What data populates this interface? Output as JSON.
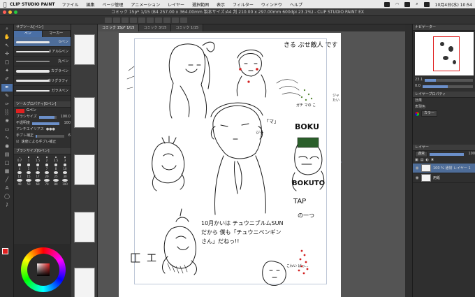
{
  "menubar": {
    "app_name": "CLIP STUDIO PAINT",
    "items": [
      "ファイル",
      "編集",
      "ページ管理",
      "アニメーション",
      "レイヤー",
      "選択範囲",
      "表示",
      "フィルター",
      "ウィンドウ",
      "ヘルプ"
    ],
    "datetime": "10月4日(水)  10:54"
  },
  "titlebar": {
    "title": "コミック 15p* 1/15 (B4 257.00 x 364.00mm 製本サイズ:A4 判 210.00 x 297.00mm 600dpi 23.1%) - CLIP STUDIO PAINT EX"
  },
  "doc_tabs": [
    "コミック 15p* 1/15",
    "コミック 3/15",
    "コミック 1/15"
  ],
  "subtool": {
    "title": "サブツール[ペン]",
    "tabs": [
      "ペン",
      "マーカー"
    ],
    "brushes": [
      {
        "name": "Gペン",
        "selected": true
      },
      {
        "name": "リアルGペン",
        "selected": false
      },
      {
        "name": "丸ペン",
        "selected": false
      },
      {
        "name": "カブラペン",
        "selected": false
      },
      {
        "name": "カリグラフィ",
        "selected": false
      },
      {
        "name": "ガラスペン",
        "selected": false
      }
    ]
  },
  "tool_property": {
    "title": "ツールプロパティ[Gペン]",
    "brush_name": "Gペン",
    "size_label": "ブラシサイズ",
    "size_value": "100.0",
    "opacity_label": "不透明度",
    "opacity_value": "100",
    "antialias_label": "アンチエイリアス",
    "stabilization_label": "手ブレ補正",
    "stabilization_value": "6",
    "speed_label": "速度による手ブレ補正",
    "speed_checked": true
  },
  "brush_size": {
    "title": "ブラシサイズ[Gペン]",
    "sizes": [
      "0.7",
      "1",
      "1.5",
      "2",
      "2.5",
      "3",
      "4",
      "5",
      "6",
      "7",
      "8",
      "10",
      "12",
      "15",
      "17",
      "20",
      "25",
      "30",
      "40",
      "50",
      "60",
      "70",
      "80",
      "100"
    ]
  },
  "colors": {
    "main": "#e02020",
    "sub": "#ffffff",
    "accent": "#4a6fa5"
  },
  "drawing_text": [
    "きる ぷせ敵人 です",
    "ガチ マの こ",
    "ジャ たい",
    "BOKU",
    "BOKUTO",
    "TAP",
    "の一つ",
    "10月かいは チュウニブルムSUNだから 僕も「チュウニペンギンさん」だねっ!!",
    "ジャ",
    "こわい ばっ…",
    "工",
    "「マ」"
  ],
  "navigator": {
    "title": "ナビゲーター"
  },
  "layer_property": {
    "title": "レイヤープロパティ",
    "effect_label": "効果",
    "blend_label": "表現色",
    "blend_value": "カラー"
  },
  "layers": {
    "title": "レイヤー",
    "blend_mode": "通常",
    "opacity": "100",
    "rows": [
      {
        "name": "100 % 通常 レイヤー 1",
        "selected": true
      },
      {
        "name": "用紙",
        "selected": false
      }
    ]
  },
  "canvas": {
    "zoom": "23.1",
    "rotation": "0.0"
  },
  "icons": [
    "pen-icon",
    "eraser-icon",
    "fill-icon",
    "text-icon",
    "hand-icon",
    "zoom-icon",
    "eye-icon",
    "gear-icon",
    "layer-icon",
    "search-icon"
  ]
}
